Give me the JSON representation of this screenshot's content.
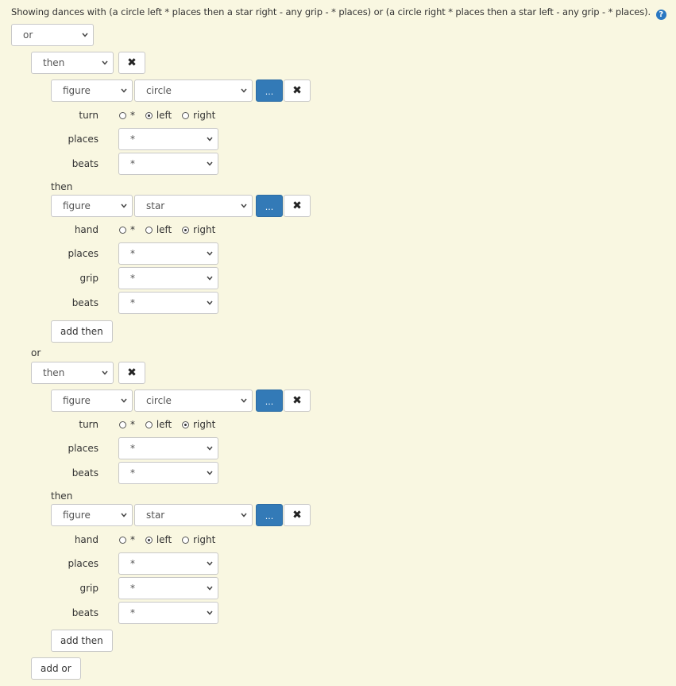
{
  "summary": {
    "text": "Showing dances with (a circle left * places then a star right - any grip - * places) or (a circle right * places then a star left - any grip - * places).",
    "help_glyph": "?"
  },
  "root": {
    "operator": "or",
    "or_label": "or",
    "add_or_label": "add or"
  },
  "groups": [
    {
      "operator": "then",
      "delete_glyph": "✖",
      "figures": [
        {
          "kind": "figure",
          "move": "circle",
          "more_glyph": "...",
          "delete_glyph": "✖",
          "params": [
            {
              "label": "turn",
              "type": "radio",
              "options": [
                "*",
                "left",
                "right"
              ],
              "selected": "left"
            },
            {
              "label": "places",
              "type": "select",
              "value": "*"
            },
            {
              "label": "beats",
              "type": "select",
              "value": "*"
            }
          ]
        },
        {
          "then_label": "then",
          "kind": "figure",
          "move": "star",
          "more_glyph": "...",
          "delete_glyph": "✖",
          "params": [
            {
              "label": "hand",
              "type": "radio",
              "options": [
                "*",
                "left",
                "right"
              ],
              "selected": "right"
            },
            {
              "label": "places",
              "type": "select",
              "value": "*"
            },
            {
              "label": "grip",
              "type": "select",
              "value": "*"
            },
            {
              "label": "beats",
              "type": "select",
              "value": "*"
            }
          ]
        }
      ],
      "add_then_label": "add then"
    },
    {
      "operator": "then",
      "delete_glyph": "✖",
      "figures": [
        {
          "kind": "figure",
          "move": "circle",
          "more_glyph": "...",
          "delete_glyph": "✖",
          "params": [
            {
              "label": "turn",
              "type": "radio",
              "options": [
                "*",
                "left",
                "right"
              ],
              "selected": "right"
            },
            {
              "label": "places",
              "type": "select",
              "value": "*"
            },
            {
              "label": "beats",
              "type": "select",
              "value": "*"
            }
          ]
        },
        {
          "then_label": "then",
          "kind": "figure",
          "move": "star",
          "more_glyph": "...",
          "delete_glyph": "✖",
          "params": [
            {
              "label": "hand",
              "type": "radio",
              "options": [
                "*",
                "left",
                "right"
              ],
              "selected": "left"
            },
            {
              "label": "places",
              "type": "select",
              "value": "*"
            },
            {
              "label": "grip",
              "type": "select",
              "value": "*"
            },
            {
              "label": "beats",
              "type": "select",
              "value": "*"
            }
          ]
        }
      ],
      "add_then_label": "add then"
    }
  ]
}
